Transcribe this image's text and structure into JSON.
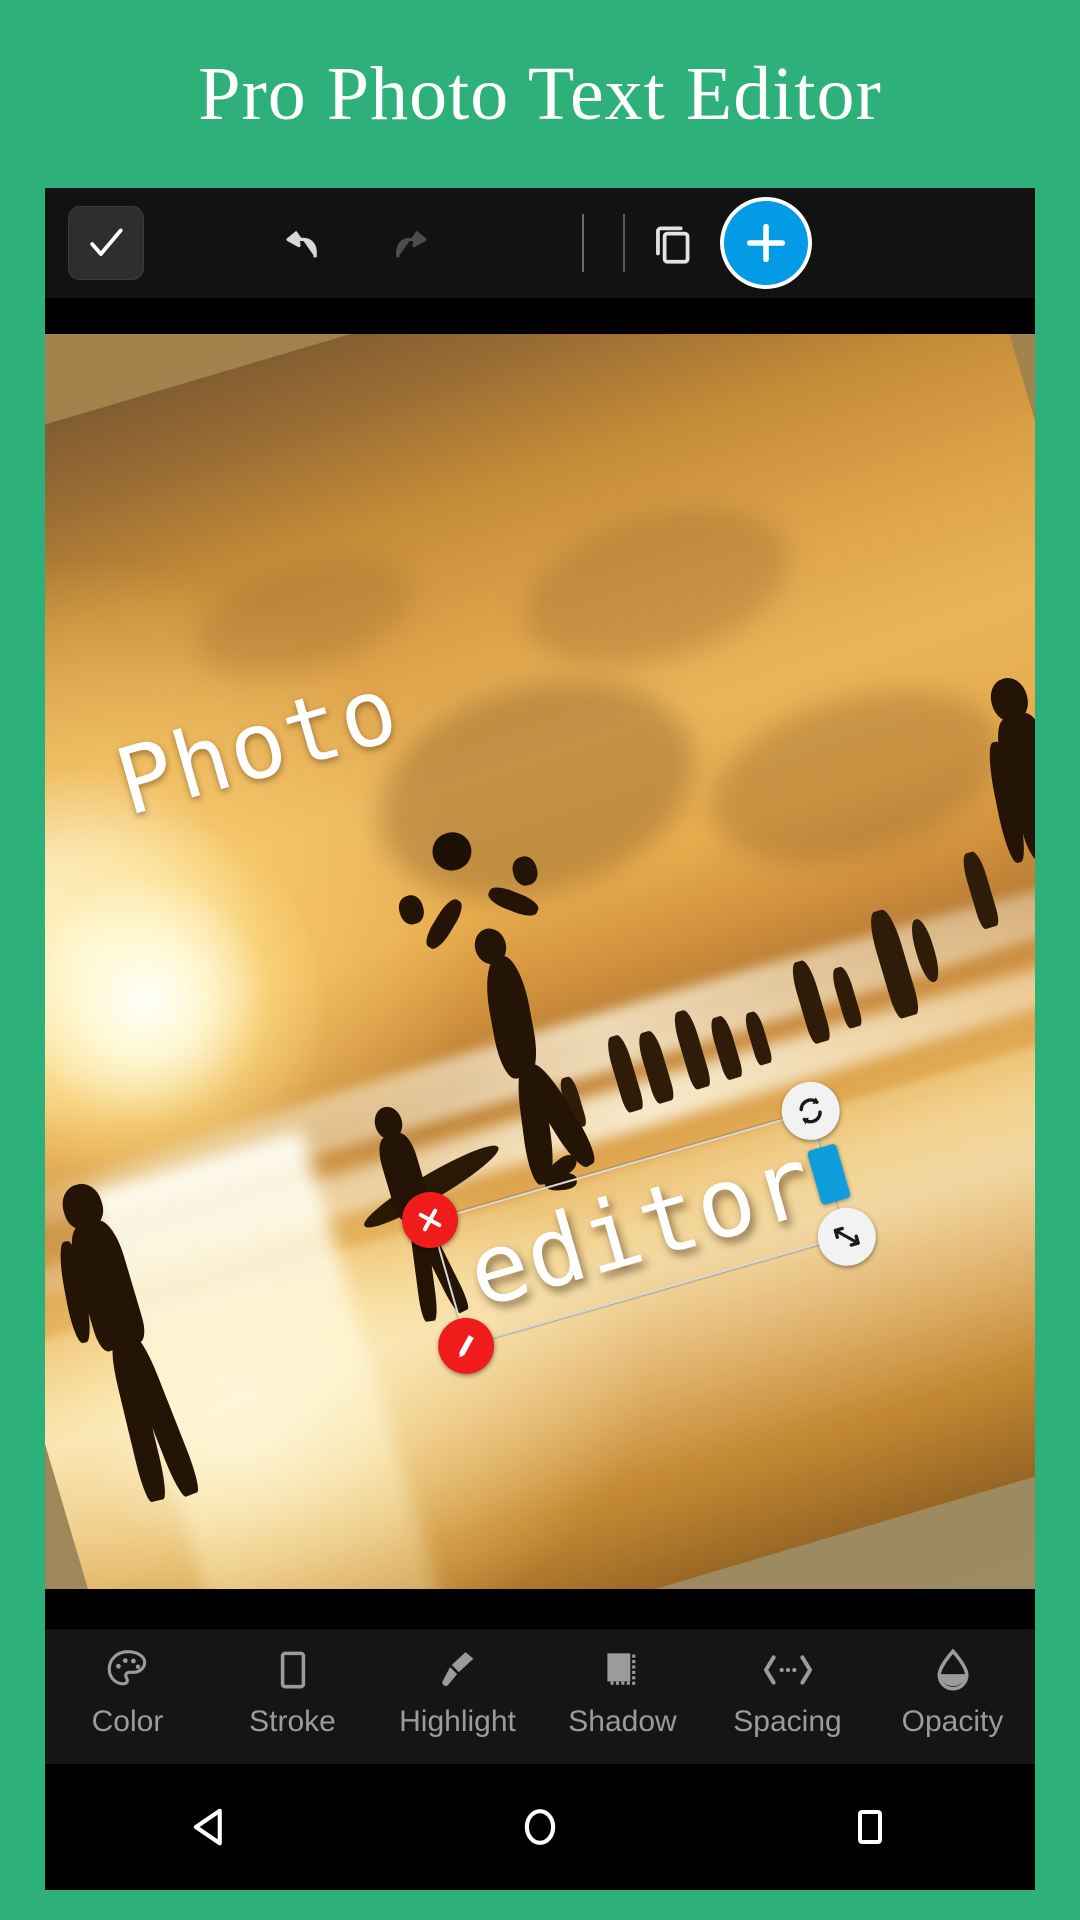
{
  "promo": {
    "title": "Pro Photo Text Editor",
    "background_color": "#2EB07A",
    "title_color": "#FFFFFF"
  },
  "top_toolbar": {
    "background_color": "#121212",
    "buttons": [
      {
        "name": "done",
        "icon": "check-icon",
        "label": "Done"
      },
      {
        "name": "undo",
        "icon": "undo-arrow-icon",
        "label": "Undo"
      },
      {
        "name": "redo",
        "icon": "redo-arrow-icon",
        "label": "Redo"
      },
      {
        "name": "layers",
        "icon": "copy-layers-icon",
        "label": "Layers"
      },
      {
        "name": "add",
        "icon": "plus-icon",
        "label": "Add",
        "color": "#039BE5"
      }
    ]
  },
  "canvas": {
    "backdrop_color": "#A3824C",
    "photo_rotation_deg": -16.5,
    "text_layers": [
      {
        "id": "photo-layer",
        "content": "Photo",
        "color": "#FFFFFF",
        "rotation_deg": -16,
        "selected": false
      },
      {
        "id": "editor-layer",
        "content": "editor",
        "color": "#FFFFFF",
        "rotation_deg": -16,
        "selected": true
      }
    ],
    "selection_handles": [
      {
        "name": "delete",
        "icon": "close-x-icon",
        "color": "#F01C1C"
      },
      {
        "name": "edit",
        "icon": "pencil-icon",
        "color": "#F01C1C"
      },
      {
        "name": "rotate",
        "icon": "rotate-icon",
        "color": "#F2F2F2"
      },
      {
        "name": "resize",
        "icon": "resize-arrows-icon",
        "color": "#F2F2F2"
      },
      {
        "name": "cursor",
        "icon": "text-cursor-handle",
        "color": "#0D9DDB"
      }
    ]
  },
  "tools_bar": {
    "background_color": "#151515",
    "label_color": "#9B9B9B",
    "items": [
      {
        "label": "Color",
        "icon": "palette-icon"
      },
      {
        "label": "Stroke",
        "icon": "rectangle-outline-icon"
      },
      {
        "label": "Highlight",
        "icon": "marker-pen-icon"
      },
      {
        "label": "Shadow",
        "icon": "shadow-square-icon"
      },
      {
        "label": "Spacing",
        "icon": "spacing-arrows-icon"
      },
      {
        "label": "Opacity",
        "icon": "droplet-icon"
      }
    ]
  },
  "nav_bar": {
    "background_color": "#000000",
    "buttons": [
      {
        "name": "back",
        "icon": "back-triangle-icon",
        "label": "Back"
      },
      {
        "name": "home",
        "icon": "home-circle-icon",
        "label": "Home"
      },
      {
        "name": "recents",
        "icon": "recents-square-icon",
        "label": "Recents"
      }
    ]
  }
}
